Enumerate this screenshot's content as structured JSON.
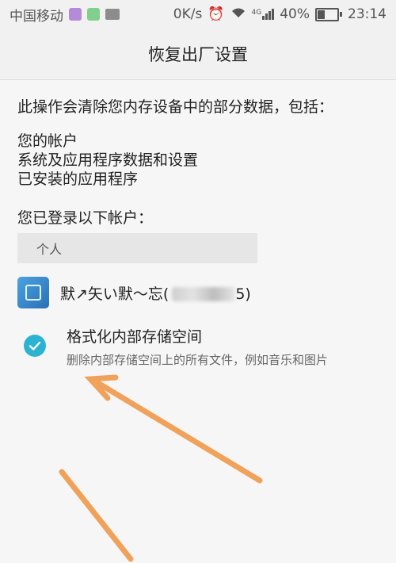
{
  "statusbar": {
    "carrier": "中国移动",
    "speed": "0K/s",
    "signal_label": "4G",
    "battery": "40%",
    "battery_level": 0.4,
    "time": "23:14"
  },
  "header": {
    "title": "恢复出厂设置"
  },
  "intro": {
    "text": "此操作会清除您内存设备中的部分数据，包括："
  },
  "items": [
    "您的帐户",
    "系统及应用程序数据和设置",
    "已安装的应用程序"
  ],
  "accounts": {
    "heading": "您已登录以下帐户：",
    "category": "个人",
    "account_name_prefix": "默↗矢い默～忘(",
    "account_name_suffix": "5)"
  },
  "option": {
    "title": "格式化内部存储空间",
    "subtitle": "删除内部存储空间上的所有文件，例如音乐和图片",
    "checked": true
  },
  "colors": {
    "check_accent": "#2bb3d1",
    "annotation_arrow": "#f0a15a"
  }
}
